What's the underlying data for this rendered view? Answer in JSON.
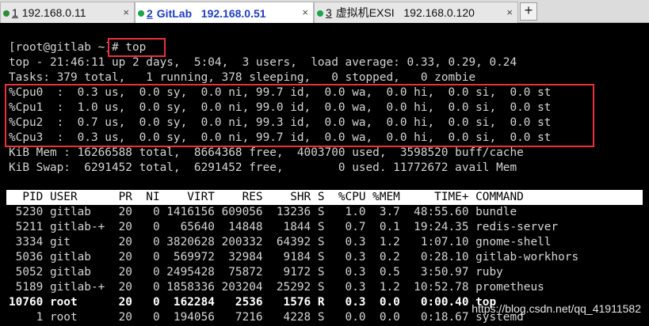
{
  "tabs": [
    {
      "number": "1",
      "name": "192.168.0.11",
      "active": false,
      "dot_color": "#2e8b3a"
    },
    {
      "number": "2",
      "name": "GitLab   192.168.0.51",
      "active": true,
      "dot_color": "#1aa64a"
    },
    {
      "number": "3",
      "name": "虚拟机EXSI   192.168.0.120",
      "active": false,
      "dot_color": "#1aa64a"
    }
  ],
  "close_symbol": "×",
  "add_tab_symbol": "+",
  "terminal": {
    "prompt": "[root@gitlab ~]# top",
    "lines": [
      "top - 21:46:11 up 2 days,  5:04,  3 users,  load average: 0.33, 0.29, 0.24",
      "Tasks: 379 total,   1 running, 378 sleeping,   0 stopped,   0 zombie",
      "%Cpu0  :  0.3 us,  0.0 sy,  0.0 ni, 99.7 id,  0.0 wa,  0.0 hi,  0.0 si,  0.0 st",
      "%Cpu1  :  1.0 us,  0.0 sy,  0.0 ni, 99.0 id,  0.0 wa,  0.0 hi,  0.0 si,  0.0 st",
      "%Cpu2  :  0.7 us,  0.0 sy,  0.0 ni, 99.3 id,  0.0 wa,  0.0 hi,  0.0 si,  0.0 st",
      "%Cpu3  :  0.3 us,  0.0 sy,  0.0 ni, 99.7 id,  0.0 wa,  0.0 hi,  0.0 si,  0.0 st",
      "KiB Mem : 16266588 total,  8664368 free,  4003700 used,  3598520 buff/cache",
      "KiB Swap:  6291452 total,  6291452 free,        0 used. 11772672 avail Mem"
    ],
    "table_header": "  PID USER      PR  NI    VIRT    RES    SHR S  %CPU %MEM     TIME+ COMMAND",
    "processes": [
      " 5230 gitlab    20   0 1416156 609056  13236 S   1.0  3.7  48:55.60 bundle",
      " 5211 gitlab-+  20   0   65640  14848   1844 S   0.7  0.1  19:24.35 redis-server",
      " 3334 git       20   0 3820628 200332  64392 S   0.3  1.2   1:07.10 gnome-shell",
      " 5036 gitlab    20   0  569972  32984   9184 S   0.3  0.2   0:28.10 gitlab-workhors",
      " 5052 gitlab    20   0 2495428  75872   9172 S   0.3  0.5   3:50.97 ruby",
      " 5189 gitlab-+  20   0 1858336 203204  25292 S   0.3  1.2  10:52.78 prometheus",
      "10760 root      20   0  162284   2536   1576 R   0.3  0.0   0:00.40 top",
      "    1 root      20   0  194056   7216   4228 S   0.0  0.0   0:18.67 systemd"
    ]
  },
  "watermark": "https://blog.csdn.net/qq_41911582",
  "colors": {
    "annotation_box": "#e8323c",
    "active_tab_text": "#1f3fbf"
  }
}
